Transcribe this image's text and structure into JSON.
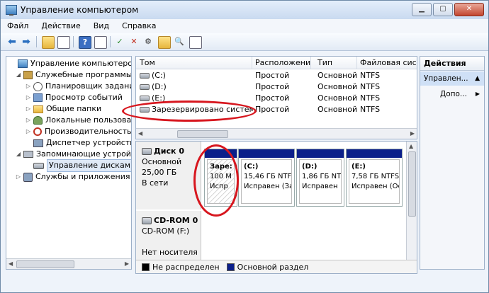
{
  "window": {
    "title": "Управление компьютером",
    "min_label": "▁",
    "max_label": "▢",
    "close_label": "✕"
  },
  "menu": [
    "Файл",
    "Действие",
    "Вид",
    "Справка"
  ],
  "toolbar": {
    "icons": [
      "back-arrow-icon",
      "forward-arrow-icon",
      "up-folder-icon",
      "show-hide-tree-icon",
      "help-icon",
      "view-icon",
      "refresh-icon",
      "close-icon",
      "properties-icon",
      "folder-open-icon",
      "search-icon",
      "grid-icon"
    ]
  },
  "tree": {
    "items": [
      {
        "label": "Управление компьютером (л",
        "icon": "computer-icon",
        "level": 0,
        "exp": ""
      },
      {
        "label": "Служебные программы",
        "icon": "tools-icon",
        "level": 1,
        "exp": "◢"
      },
      {
        "label": "Планировщик заданий",
        "icon": "clock-icon",
        "level": 2,
        "exp": "▷"
      },
      {
        "label": "Просмотр событий",
        "icon": "event-viewer-icon",
        "level": 2,
        "exp": "▷"
      },
      {
        "label": "Общие папки",
        "icon": "shared-folder-icon",
        "level": 2,
        "exp": "▷"
      },
      {
        "label": "Локальные пользовате",
        "icon": "users-icon",
        "level": 2,
        "exp": "▷"
      },
      {
        "label": "Производительность",
        "icon": "performance-icon",
        "level": 2,
        "exp": "▷"
      },
      {
        "label": "Диспетчер устройств",
        "icon": "device-manager-icon",
        "level": 2,
        "exp": ""
      },
      {
        "label": "Запоминающие устройст",
        "icon": "storage-icon",
        "level": 1,
        "exp": "◢"
      },
      {
        "label": "Управление дисками",
        "icon": "disk-icon",
        "level": 2,
        "exp": "",
        "selected": true
      },
      {
        "label": "Службы и приложения",
        "icon": "services-icon",
        "level": 1,
        "exp": "▷"
      }
    ]
  },
  "volumes": {
    "headers": [
      "Том",
      "Расположение",
      "Тип",
      "Файловая систе"
    ],
    "rows": [
      [
        "(C:)",
        "Простой",
        "Основной",
        "NTFS"
      ],
      [
        "(D:)",
        "Простой",
        "Основной",
        "NTFS"
      ],
      [
        "(E:)",
        "Простой",
        "Основной",
        "NTFS"
      ],
      [
        "Зарезервировано системой",
        "Простой",
        "Основной",
        "NTFS"
      ]
    ]
  },
  "disk0": {
    "name": "Диск 0",
    "type": "Основной",
    "size": "25,00 ГБ",
    "status": "В сети",
    "partitions": [
      {
        "name": "Заре:",
        "line1": "100 М",
        "line2": "Испр"
      },
      {
        "name": "(C:)",
        "line1": "15,46 ГБ NTFS",
        "line2": "Исправен (Заг"
      },
      {
        "name": "(D:)",
        "line1": "1,86 ГБ NTFS",
        "line2": "Исправен"
      },
      {
        "name": "(E:)",
        "line1": "7,58 ГБ NTFS",
        "line2": "Исправен (Ос"
      }
    ]
  },
  "cdrom0": {
    "name": "CD-ROM 0",
    "device": "CD-ROM (F:)",
    "media": "Нет носителя"
  },
  "legend": {
    "unallocated": "Не распределен",
    "primary": "Основной раздел",
    "unallocated_color": "#000000",
    "primary_color": "#0b1f8a"
  },
  "actions": {
    "header": "Действия",
    "selected": "Управлен...",
    "more": "Допо..."
  },
  "annotation_color": "#d7161e"
}
